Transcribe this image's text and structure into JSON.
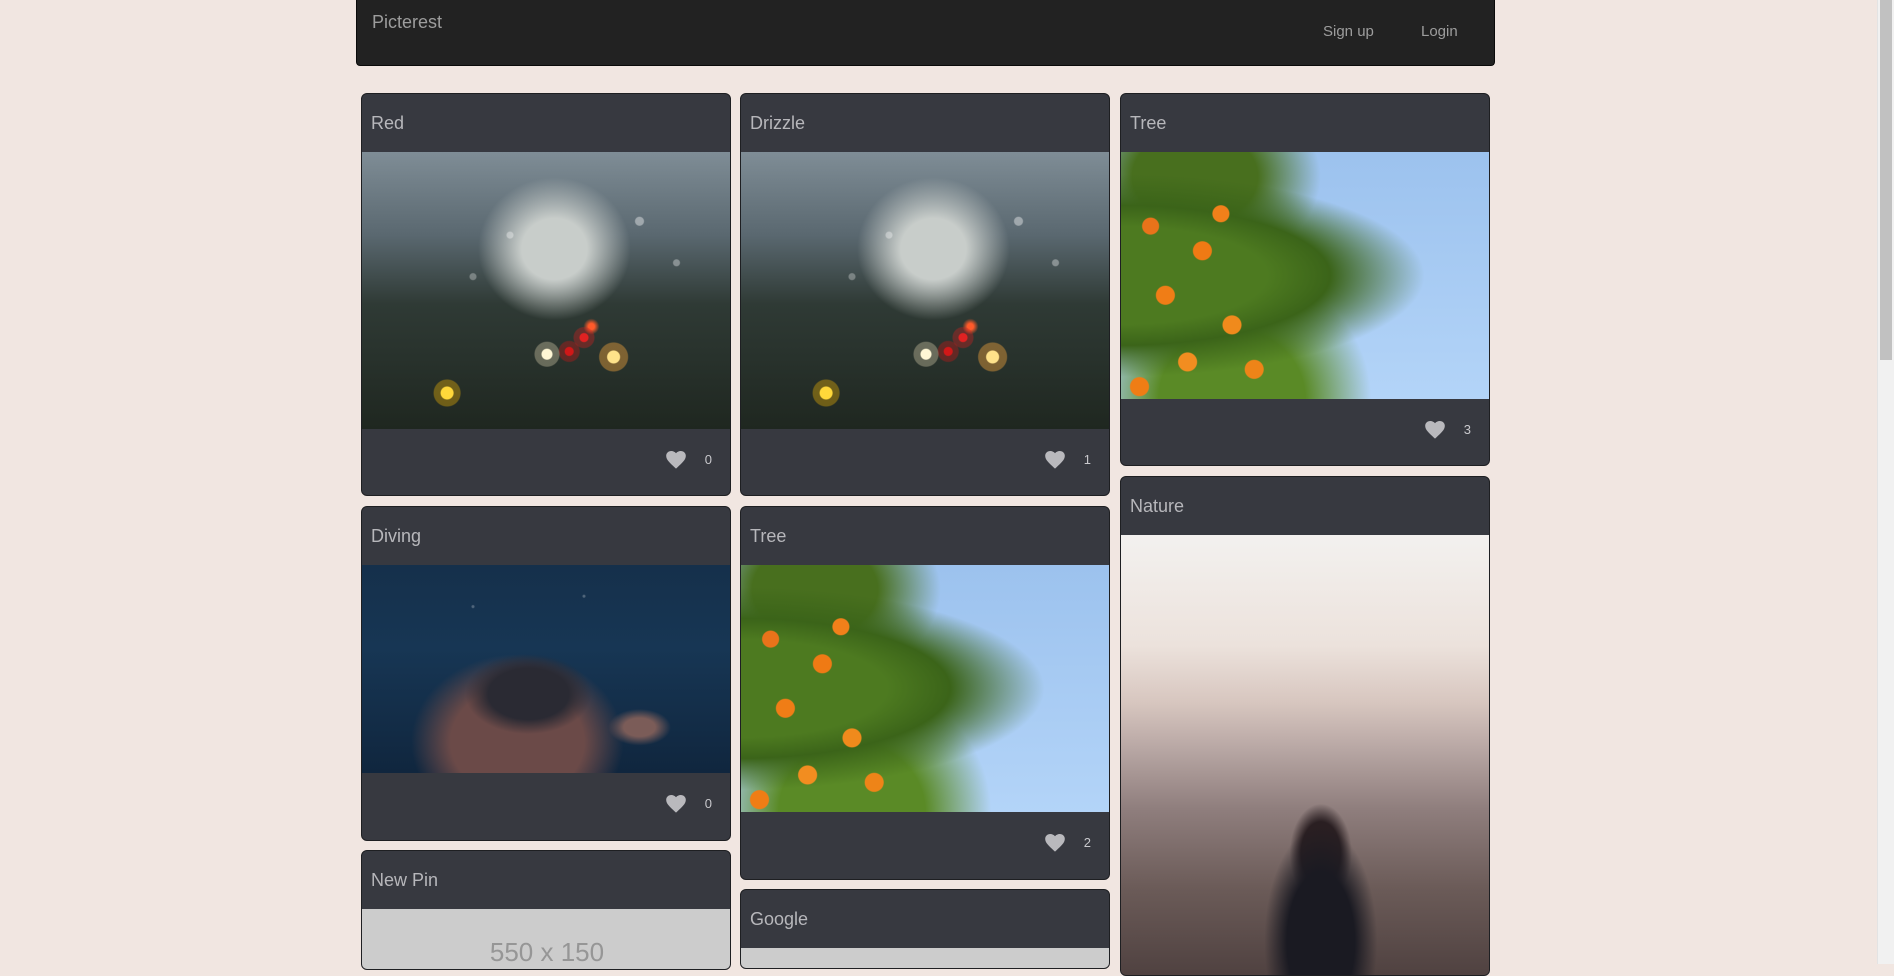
{
  "navbar": {
    "brand": "Picterest",
    "links": [
      "Sign up",
      "Login"
    ]
  },
  "pins": [
    {
      "title": "Red",
      "image": "rain-on-window",
      "likes": "0"
    },
    {
      "title": "Drizzle",
      "image": "rain-on-window",
      "likes": "1"
    },
    {
      "title": "Tree",
      "image": "orange-tree",
      "likes": "3"
    },
    {
      "title": "Diving",
      "image": "underwater-diver",
      "likes": "0"
    },
    {
      "title": "Tree",
      "image": "orange-tree",
      "likes": "2"
    },
    {
      "title": "Nature",
      "image": "woman-overlooking-city"
    },
    {
      "title": "New Pin",
      "image": "placeholder",
      "placeholder_text": "550 x 150"
    },
    {
      "title": "Google",
      "image": "placeholder"
    }
  ],
  "icons": {
    "like": "heart-icon"
  },
  "colors": {
    "page_background": "#f1e6e1",
    "navbar": "#222222",
    "card": "#373940"
  }
}
